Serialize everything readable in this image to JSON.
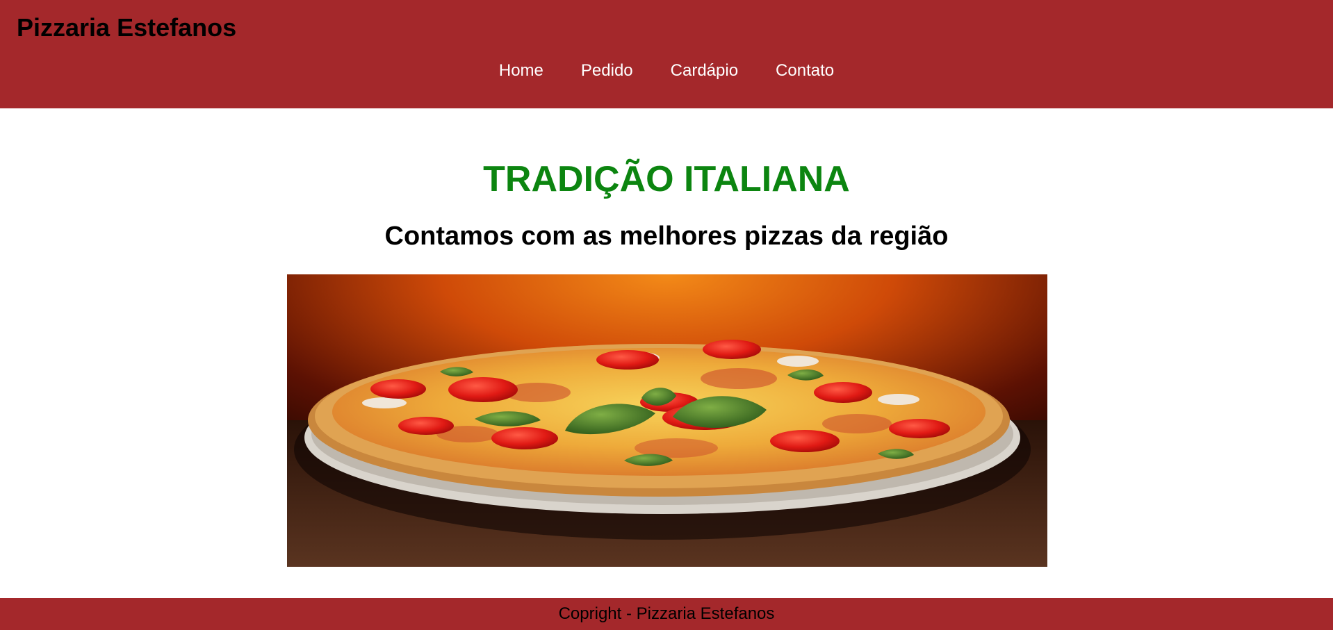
{
  "header": {
    "brand": "Pizzaria Estefanos",
    "nav": [
      "Home",
      "Pedido",
      "Cardápio",
      "Contato"
    ]
  },
  "main": {
    "headline": "TRADIÇÃO ITALIANA",
    "subheadline": "Contamos com as melhores pizzas da região",
    "hero_image": "pizza-photo"
  },
  "footer": {
    "copyright": "Copright - Pizzaria Estefanos"
  },
  "colors": {
    "header_bg": "#a4282b",
    "headline": "#0c8510",
    "nav_text": "#ffffff"
  }
}
